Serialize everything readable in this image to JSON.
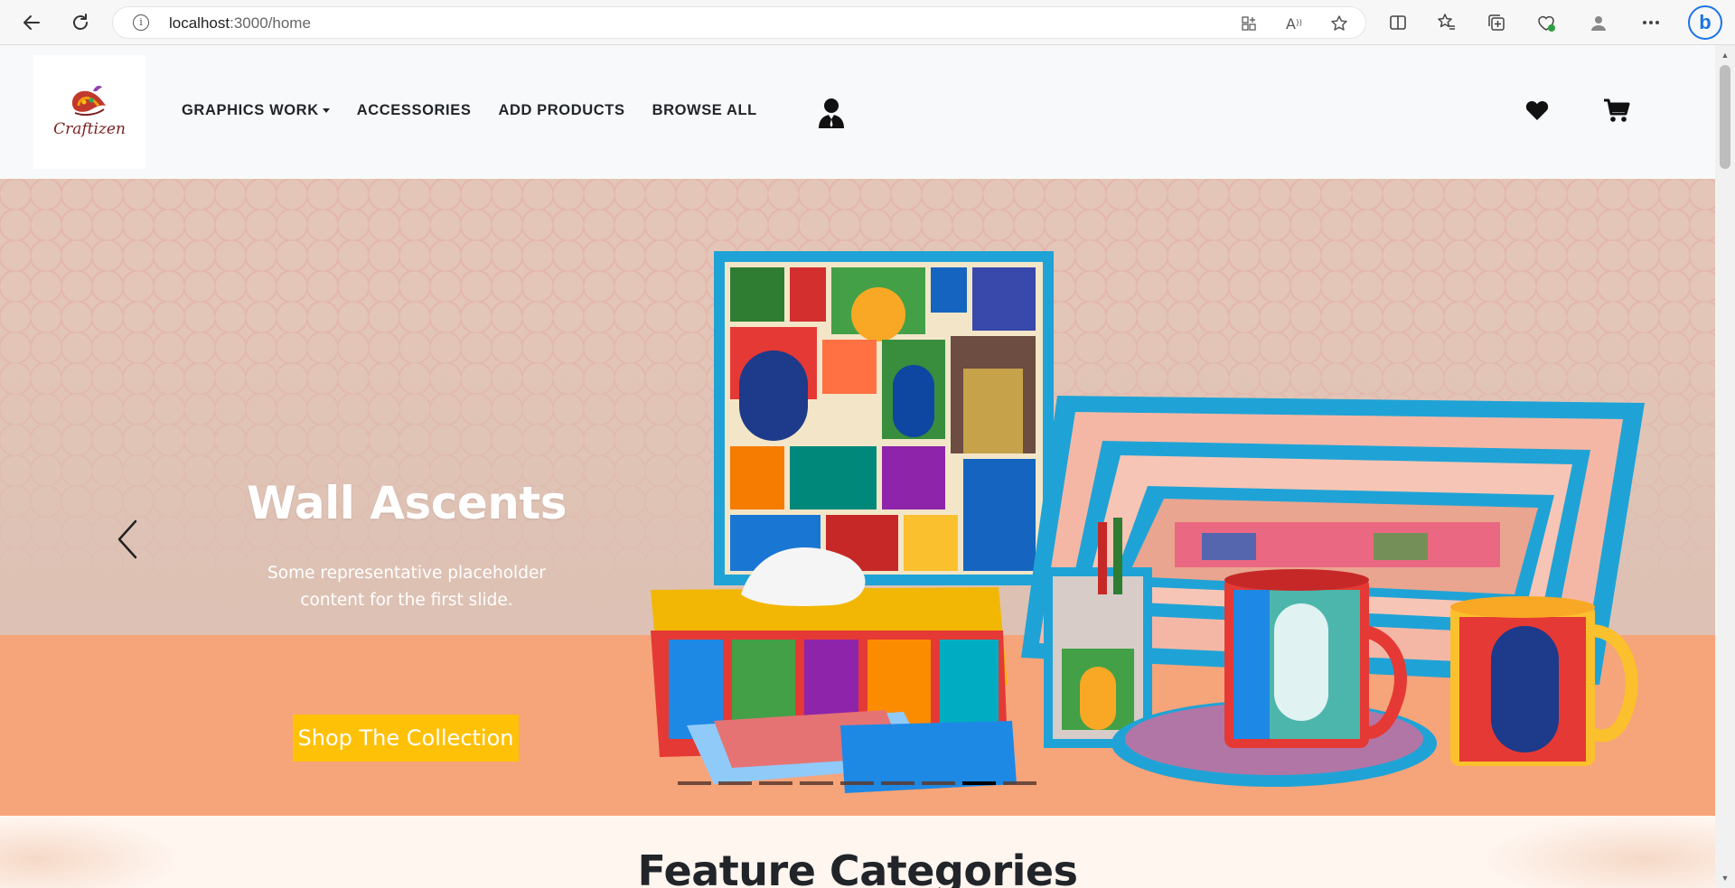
{
  "browser": {
    "url_host": "localhost",
    "url_path": ":3000/home"
  },
  "navbar": {
    "logo_text": "Craftizen",
    "menu": [
      {
        "label": "GRAPHICS WORK",
        "has_dropdown": true
      },
      {
        "label": "ACCESSORIES"
      },
      {
        "label": "ADD PRODUCTS"
      },
      {
        "label": "BROWSE ALL"
      }
    ],
    "icons": {
      "user": "user-icon",
      "wishlist": "heart-icon",
      "cart": "cart-icon"
    }
  },
  "hero": {
    "title": "Wall Ascents",
    "text_line1": "Some representative placeholder",
    "text_line2": "content for the first slide.",
    "button_label": "Shop The Collection",
    "slide_count": 9,
    "active_slide": 8,
    "colors": {
      "button": "#ffc107",
      "floor": "#f6a47a",
      "wall": "#e3c6b7"
    }
  },
  "feature": {
    "title": "Feature Categories"
  }
}
